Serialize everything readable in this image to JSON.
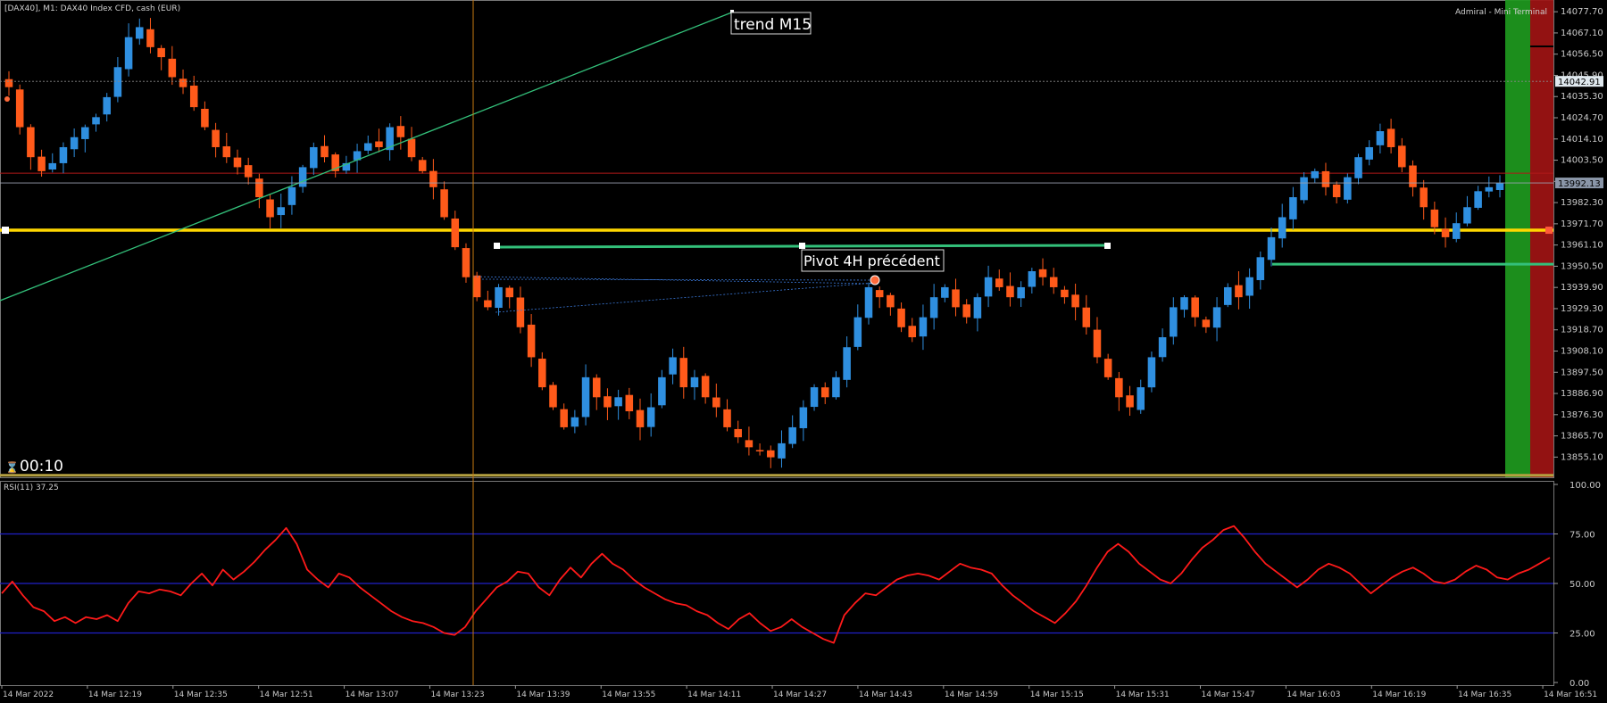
{
  "chart_title": "[DAX40], M1:  DAX40 Index CFD, cash (EUR)",
  "broker_label": "Admiral - Mini Terminal",
  "countdown": "00:10",
  "annotations": {
    "trend_label": "trend M15",
    "pivot_label": "Pivot 4H précédent"
  },
  "colors": {
    "background": "#000000",
    "bull": "#2f8fe0",
    "bear": "#ff5a1a",
    "yellow_line": "#ffd700",
    "trend_line": "#33c07a",
    "pivot_line": "#33c07a",
    "rsi_line": "#ff1a1a",
    "rsi_levels": "#2020c8",
    "zone_green": "#1e9a1e",
    "zone_red": "#a01414"
  },
  "chart_data": [
    {
      "type": "candlestick",
      "timeframe": "M1",
      "y_axis_ticks": [
        "14077.70",
        "14067.10",
        "14056.50",
        "14045.90",
        "14035.30",
        "14024.70",
        "14014.10",
        "14003.50",
        "13992.90",
        "13982.30",
        "13971.70",
        "13961.10",
        "13950.50",
        "13939.90",
        "13929.30",
        "13918.70",
        "13908.10",
        "13897.50",
        "13886.90",
        "13876.30",
        "13865.70",
        "13855.10"
      ],
      "ylim": [
        13845.0,
        14080.0
      ],
      "x_axis_labels": [
        "14 Mar 2022",
        "14 Mar 12:19",
        "14 Mar 12:35",
        "14 Mar 12:51",
        "14 Mar 13:07",
        "14 Mar 13:23",
        "14 Mar 13:39",
        "14 Mar 13:55",
        "14 Mar 14:11",
        "14 Mar 14:27",
        "14 Mar 14:43",
        "14 Mar 14:59",
        "14 Mar 15:15",
        "14 Mar 15:31",
        "14 Mar 15:47",
        "14 Mar 16:03",
        "14 Mar 16:19",
        "14 Mar 16:35",
        "14 Mar 16:51"
      ],
      "price_markers": [
        {
          "value": 14042.91,
          "label": "14042.91"
        },
        {
          "value": 13992.13,
          "label": "13992.13"
        }
      ],
      "horizontal_levels": [
        {
          "name": "yellow support",
          "value": 13968.5
        },
        {
          "name": "pivot 4H",
          "value": 13960.5
        },
        {
          "name": "right green level",
          "value": 13951.5
        },
        {
          "name": "red line",
          "value": 13997.0
        },
        {
          "name": "bottom yellow",
          "value": 13846.0
        }
      ],
      "close_series": [
        14040,
        14020,
        14005,
        13998,
        14002,
        14010,
        14015,
        14020,
        14025,
        14035,
        14050,
        14065,
        14070,
        14060,
        14055,
        14045,
        14040,
        14030,
        14020,
        14010,
        14005,
        14000,
        13995,
        13985,
        13975,
        13980,
        13990,
        14000,
        14010,
        14005,
        13998,
        14002,
        14008,
        14012,
        14010,
        14020,
        14015,
        14005,
        13998,
        13990,
        13975,
        13960,
        13945,
        13935,
        13930,
        13940,
        13935,
        13920,
        13905,
        13890,
        13880,
        13870,
        13875,
        13895,
        13885,
        13880,
        13885,
        13878,
        13870,
        13880,
        13895,
        13905,
        13890,
        13895,
        13885,
        13880,
        13870,
        13865,
        13860,
        13858,
        13855,
        13862,
        13870,
        13880,
        13890,
        13885,
        13895,
        13910,
        13925,
        13940,
        13935,
        13930,
        13920,
        13915,
        13925,
        13935,
        13940,
        13930,
        13925,
        13935,
        13945,
        13940,
        13935,
        13940,
        13948,
        13945,
        13940,
        13935,
        13930,
        13920,
        13905,
        13895,
        13885,
        13880,
        13890,
        13905,
        13915,
        13930,
        13935,
        13925,
        13920,
        13930,
        13940,
        13935,
        13945,
        13955,
        13965,
        13975,
        13985,
        13995,
        13998,
        13990,
        13985,
        13995,
        14005,
        14010,
        14018,
        14010,
        14000,
        13990,
        13980,
        13970,
        13965,
        13972,
        13980,
        13988,
        13990,
        13992
      ],
      "rsi": {
        "name": "RSI(11) 37.25",
        "value": 37.25,
        "levels": [
          75,
          50,
          25
        ],
        "ylim": [
          0,
          100
        ],
        "y_axis_ticks": [
          "100.00",
          "75.00",
          "50.00",
          "25.00",
          "0.00"
        ],
        "values": [
          45,
          51,
          44,
          38,
          36,
          31,
          33,
          30,
          33,
          32,
          34,
          31,
          40,
          46,
          45,
          47,
          46,
          44,
          50,
          55,
          49,
          57,
          52,
          56,
          61,
          67,
          72,
          78,
          70,
          57,
          52,
          48,
          55,
          53,
          48,
          44,
          40,
          36,
          33,
          31,
          30,
          28,
          25,
          24,
          28,
          36,
          42,
          48,
          51,
          56,
          55,
          48,
          44,
          52,
          58,
          53,
          60,
          65,
          60,
          57,
          52,
          48,
          45,
          42,
          40,
          39,
          36,
          34,
          30,
          27,
          32,
          35,
          30,
          26,
          28,
          32,
          28,
          25,
          22,
          20,
          34,
          40,
          45,
          44,
          48,
          52,
          54,
          55,
          54,
          52,
          56,
          60,
          58,
          57,
          55,
          49,
          44,
          40,
          36,
          33,
          30,
          35,
          41,
          49,
          58,
          66,
          70,
          66,
          60,
          56,
          52,
          50,
          55,
          62,
          68,
          72,
          77,
          79,
          73,
          66,
          60,
          56,
          52,
          48,
          52,
          57,
          60,
          58,
          55,
          50,
          45,
          49,
          53,
          56,
          58,
          55,
          51,
          50,
          52,
          56,
          59,
          57,
          53,
          52,
          55,
          57,
          60,
          63
        ]
      }
    }
  ]
}
